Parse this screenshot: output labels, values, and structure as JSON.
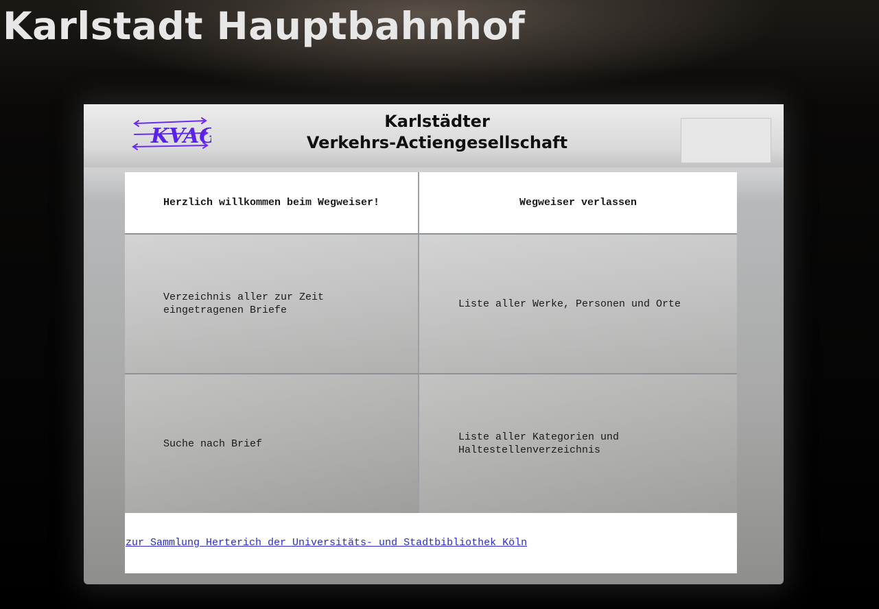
{
  "page": {
    "station_title": "Karlstadt Hauptbahnhof"
  },
  "header": {
    "logo_text": "KVAG",
    "company_line1": "Karlstädter",
    "company_line2": "Verkehrs-Actiengesellschaft"
  },
  "menu": {
    "welcome": "Herzlich willkommen beim Wegweiser!",
    "exit": "Wegweiser verlassen",
    "letters_directory": "Verzeichnis aller zur Zeit\neingetragenen Briefe",
    "works_list": "Liste aller Werke, Personen und Orte",
    "letter_search": "Suche nach Brief",
    "categories_list": "Liste aller Kategorien und\nHaltestellenverzeichnis"
  },
  "footer": {
    "library_link": "zur Sammlung Herterich der Universitäts- und Stadtbibliothek Köln"
  },
  "colors": {
    "title_text": "#e7e7e7",
    "logo": "#6a2cf0",
    "link": "#2a2ac8"
  },
  "icons": {
    "logo": "kvag-logo-arrows"
  }
}
